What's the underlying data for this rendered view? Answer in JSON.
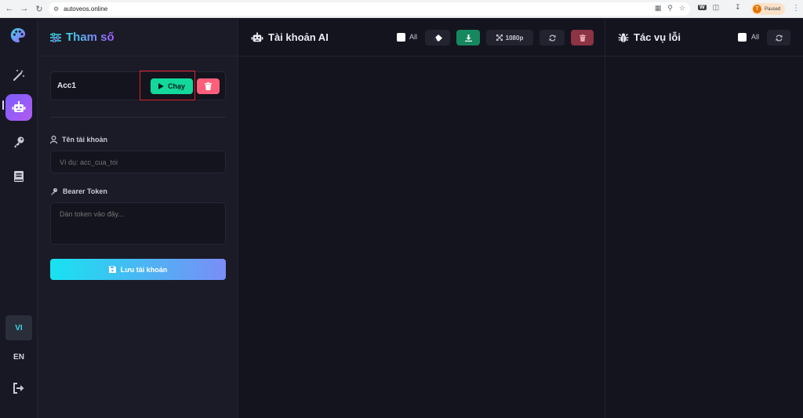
{
  "browser": {
    "url": "autoveos.online",
    "profile_initial": "T",
    "profile_status": "Paused"
  },
  "sidebar": {
    "lang_vi": "VI",
    "lang_en": "EN"
  },
  "params_panel": {
    "title": "Tham số",
    "account": {
      "name": "Acc1",
      "run_label": "Chạy"
    },
    "username_label": "Tên tài khoản",
    "username_placeholder": "Ví dụ: acc_cua_toi",
    "token_label": "Bearer Token",
    "token_placeholder": "Dán token vào đây...",
    "save_label": "Lưu tài khoản"
  },
  "accounts_panel": {
    "title": "Tài khoản AI",
    "all_label": "All",
    "resolution_label": "1080p"
  },
  "errors_panel": {
    "title": "Tác vụ lỗi",
    "all_label": "All"
  },
  "colors": {
    "accent_cyan": "#3ad7e8",
    "accent_purple": "#a35cff",
    "run_green": "#12d89b",
    "delete_red": "#ff5f7a",
    "highlight_red": "#e0202c"
  }
}
